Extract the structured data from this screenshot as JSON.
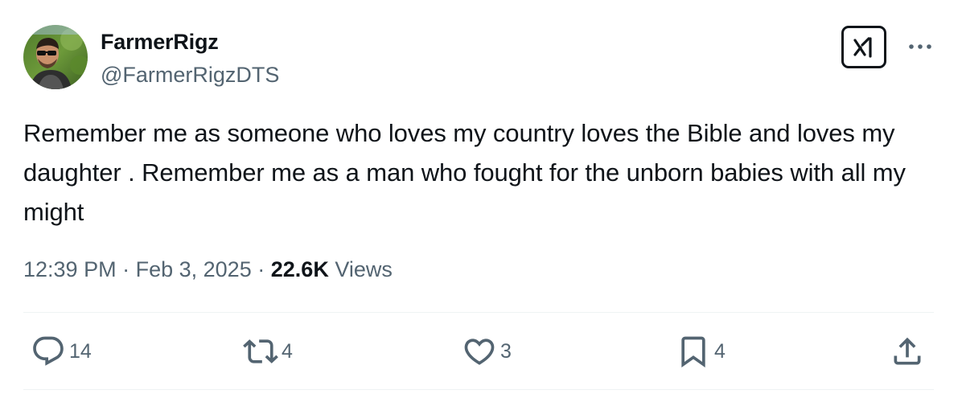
{
  "author": {
    "display_name": "FarmerRigz",
    "handle": "@FarmerRigzDTS",
    "avatar": "profile-photo"
  },
  "header_actions": {
    "grok_icon": "grok-icon",
    "more_icon": "more-horizontal-icon"
  },
  "tweet": {
    "text": "Remember me as someone who loves my country loves the Bible and loves my daughter . Remember me as a man who fought for the unborn babies with all my might",
    "time": "12:39 PM",
    "separator_1": "·",
    "date": "Feb 3, 2025",
    "separator_2": "·",
    "views_count": "22.6K",
    "views_label": "Views"
  },
  "actions": {
    "reply": {
      "icon": "reply-icon",
      "count": "14"
    },
    "repost": {
      "icon": "repost-icon",
      "count": "4"
    },
    "like": {
      "icon": "heart-icon",
      "count": "3"
    },
    "bookmark": {
      "icon": "bookmark-icon",
      "count": "4"
    },
    "share": {
      "icon": "share-icon"
    }
  },
  "colors": {
    "text_primary": "#0f1419",
    "text_secondary": "#536471",
    "divider": "#eff3f4"
  }
}
